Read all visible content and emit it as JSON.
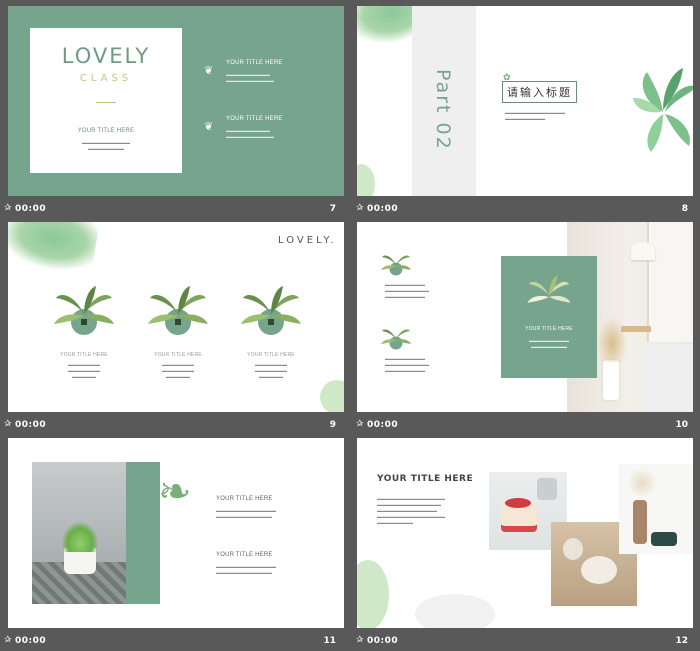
{
  "slides": [
    {
      "number": "7",
      "time": "00:00",
      "title_line1": "LOVELY",
      "title_line2": "CLASS",
      "left_heading": "YOUR TITLE HERE",
      "items": [
        {
          "heading": "YOUR TITLE HERE"
        },
        {
          "heading": "YOUR TITLE HERE"
        }
      ]
    },
    {
      "number": "8",
      "time": "00:00",
      "part": "Part 02",
      "title": "请输入标题"
    },
    {
      "number": "9",
      "time": "00:00",
      "brand": "LOVELY.",
      "items": [
        {
          "heading": "YOUR TITLE HERE"
        },
        {
          "heading": "YOUR TITLE HERE"
        },
        {
          "heading": "YOUR TITLE HERE"
        }
      ]
    },
    {
      "number": "10",
      "time": "00:00",
      "card_heading": "YOUR TITLE HERE"
    },
    {
      "number": "11",
      "time": "00:00",
      "items": [
        {
          "heading": "YOUR TITLE HERE"
        },
        {
          "heading": "YOUR TITLE HERE"
        }
      ]
    },
    {
      "number": "12",
      "time": "00:00",
      "heading": "YOUR TITLE HERE"
    }
  ],
  "colors": {
    "sage": "#76a48c",
    "background": "#595959",
    "leaf": "#8cc79a",
    "blob": "#cfe8c8"
  },
  "icons": [
    "star-icon",
    "leaf-icon",
    "plant-icon"
  ]
}
